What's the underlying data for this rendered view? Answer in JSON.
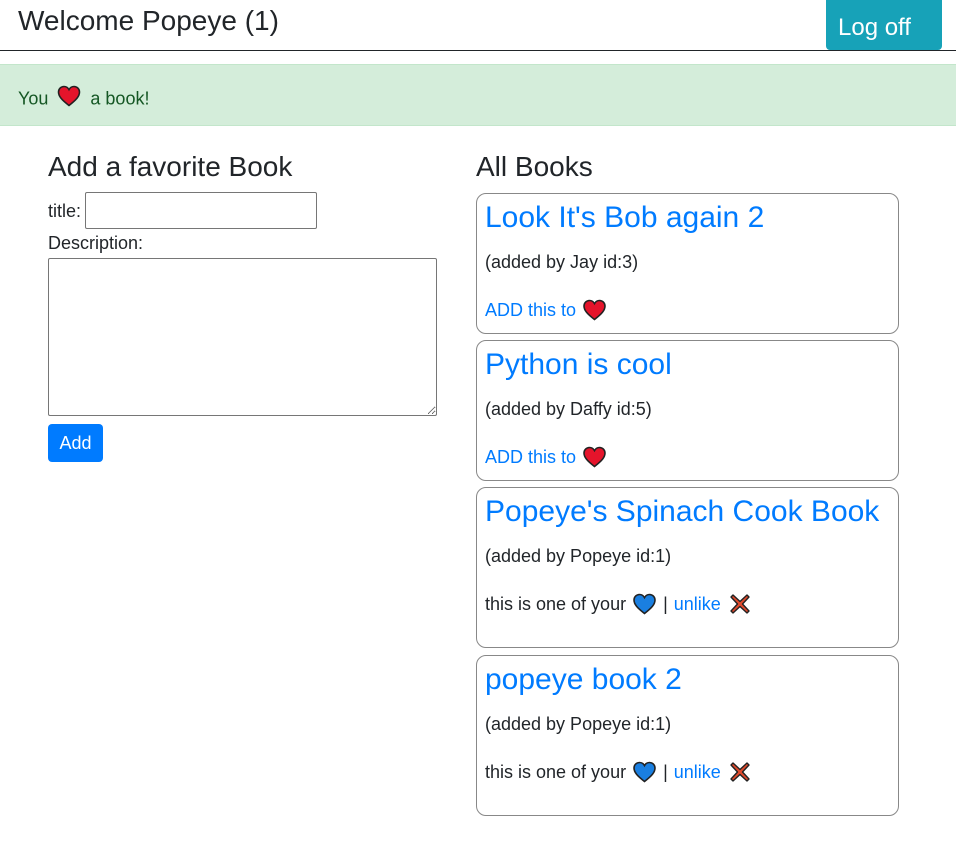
{
  "header": {
    "title": "Welcome Popeye (1)",
    "logoff_label": "Log off"
  },
  "alert": {
    "prefix": "You",
    "suffix": "a book!",
    "icon": "red-heart-icon"
  },
  "form": {
    "heading": "Add a favorite Book",
    "title_label": "title:",
    "title_value": "",
    "description_label": "Description:",
    "description_value": "",
    "submit_label": "Add"
  },
  "books": {
    "heading": "All Books",
    "items": [
      {
        "title": "Look It's Bob again 2",
        "added_by": "(added by Jay id:3)",
        "action_text": "ADD this to",
        "favorite": false
      },
      {
        "title": "Python is cool",
        "added_by": "(added by Daffy id:5)",
        "action_text": "ADD this to",
        "favorite": false
      },
      {
        "title": "Popeye's Spinach Cook Book",
        "added_by": "(added by Popeye id:1)",
        "favorite_text": "this is one of your",
        "unlike_label": "unlike",
        "favorite": true
      },
      {
        "title": "popeye book 2",
        "added_by": "(added by Popeye id:1)",
        "favorite_text": "this is one of your",
        "unlike_label": "unlike",
        "favorite": true
      }
    ]
  },
  "colors": {
    "accent": "#007bff",
    "logoff": "#17a2b8",
    "alert_bg": "#d4edda",
    "alert_text": "#155724",
    "heart_red": "#e5142b",
    "heart_blue": "#1a7fe0",
    "cross_red": "#e04a2c"
  }
}
